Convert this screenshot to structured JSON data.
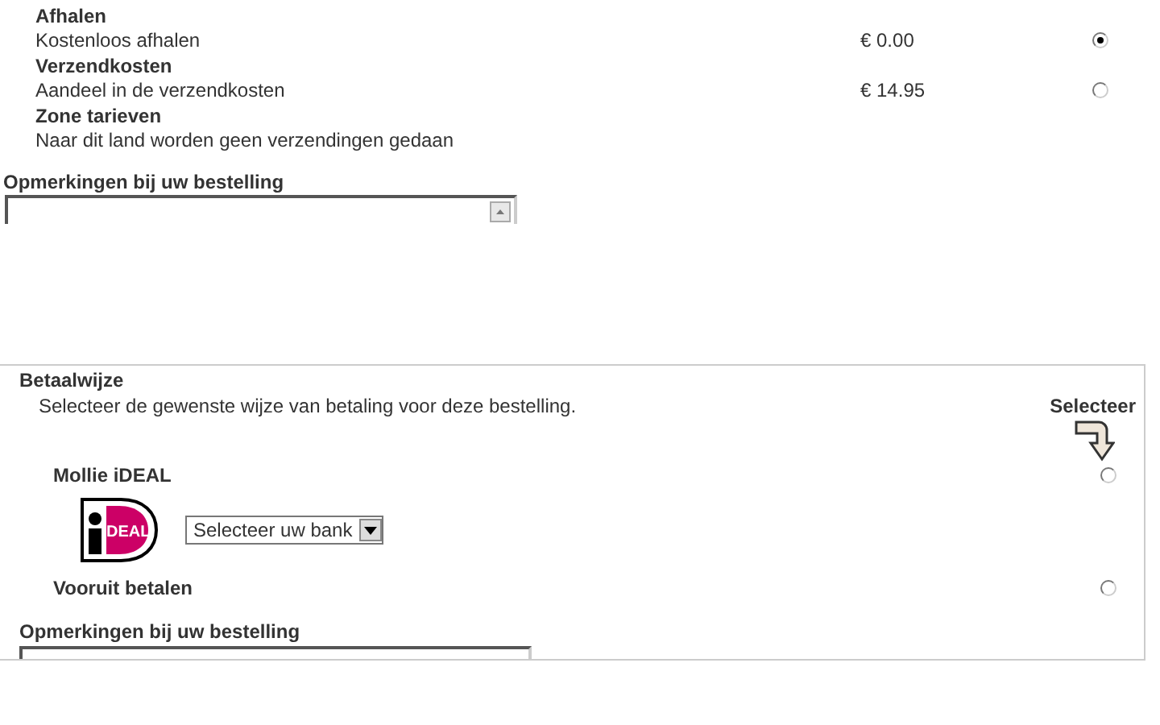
{
  "shipping_options": [
    {
      "title": "Afhalen",
      "description": "Kostenloos afhalen",
      "price": "€ 0.00",
      "selected": true,
      "kind": "option"
    },
    {
      "title": "Verzendkosten",
      "description": "Aandeel in de verzendkosten",
      "price": "€ 14.95",
      "selected": false,
      "kind": "option"
    },
    {
      "title": "Zone tarieven",
      "description": "Naar dit land worden geen verzendingen gedaan",
      "kind": "note"
    }
  ],
  "remarks": {
    "label": "Opmerkingen bij uw bestelling"
  },
  "payment": {
    "title": "Betaalwijze",
    "description": "Selecteer de gewenste wijze van betaling voor deze bestelling.",
    "select_hint": "Selecteer",
    "methods": [
      {
        "name": "Mollie iDEAL",
        "selected": false,
        "logo_text": "DEAL",
        "bank_select": "Selecteer uw bank"
      },
      {
        "name": "Vooruit betalen",
        "selected": false
      }
    ],
    "remarks_label": "Opmerkingen bij uw bestelling"
  }
}
